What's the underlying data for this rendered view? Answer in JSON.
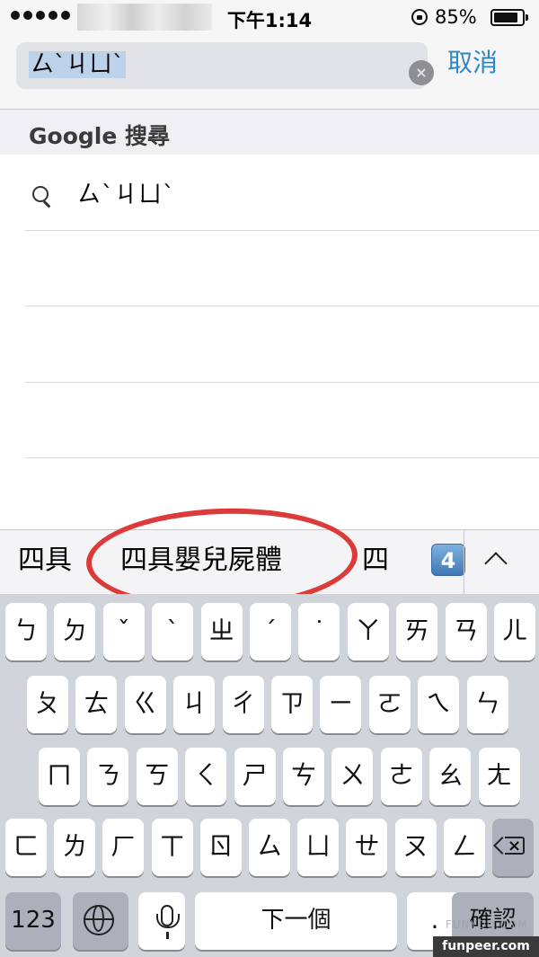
{
  "status_bar": {
    "time": "下午1:14",
    "battery": "85%",
    "battery_level": 0.85
  },
  "search": {
    "query": "ㄙˋㄐㄩˋ",
    "cancel_label": "取消"
  },
  "results": {
    "section_title": "Google 搜尋",
    "suggestions": [
      {
        "text": "ㄙˋㄐㄩˋ",
        "icon": "magnifier-icon"
      }
    ]
  },
  "candidates": {
    "items": [
      "四具",
      "四具嬰兒屍體",
      "四"
    ],
    "badge": "4",
    "expand_icon": "chevron-up-icon"
  },
  "keyboard": {
    "row1": [
      "ㄅ",
      "ㄉ",
      "ˇ",
      "ˋ",
      "ㄓ",
      "ˊ",
      "˙",
      "ㄚ",
      "ㄞ",
      "ㄢ",
      "ㄦ"
    ],
    "row2": [
      "ㄆ",
      "ㄊ",
      "ㄍ",
      "ㄐ",
      "ㄔ",
      "ㄗ",
      "ㄧ",
      "ㄛ",
      "ㄟ",
      "ㄣ"
    ],
    "row3": [
      "ㄇ",
      "ㄋ",
      "ㄎ",
      "ㄑ",
      "ㄕ",
      "ㄘ",
      "ㄨ",
      "ㄜ",
      "ㄠ",
      "ㄤ"
    ],
    "row4": [
      "ㄈ",
      "ㄌ",
      "ㄏ",
      "ㄒ",
      "ㄖ",
      "ㄙ",
      "ㄩ",
      "ㄝ",
      "ㄡ",
      "ㄥ"
    ],
    "numbers_label": "123",
    "next_label": "下一個",
    "period_label": ".",
    "confirm_label": "確認"
  },
  "watermark": {
    "text": "funpeer.com",
    "faint": "FUNYOU.COM"
  }
}
